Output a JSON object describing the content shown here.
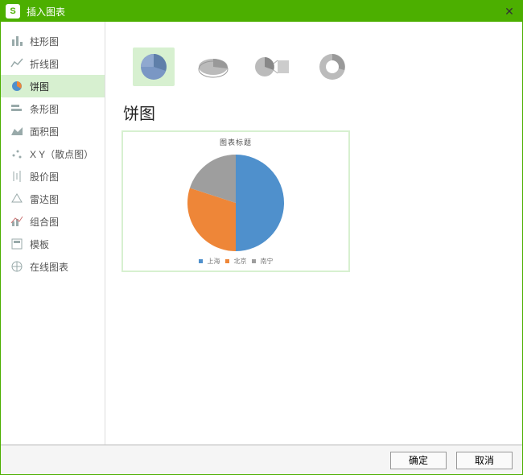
{
  "titlebar": {
    "app_badge": "S",
    "title": "插入图表",
    "close_glyph": "✕"
  },
  "sidebar": {
    "items": [
      {
        "label": "柱形图"
      },
      {
        "label": "折线图"
      },
      {
        "label": "饼图"
      },
      {
        "label": "条形图"
      },
      {
        "label": "面积图"
      },
      {
        "label": "X Y（散点图）"
      },
      {
        "label": "股价图"
      },
      {
        "label": "雷达图"
      },
      {
        "label": "组合图"
      },
      {
        "label": "模板"
      },
      {
        "label": "在线图表"
      }
    ],
    "selected_index": 2
  },
  "main": {
    "section_title": "饼图",
    "subtype_selected_index": 0,
    "preview_title": "图表标题",
    "legend_items": [
      "上海",
      "北京",
      "南宁"
    ]
  },
  "footer": {
    "ok_label": "确定",
    "cancel_label": "取消"
  },
  "colors": {
    "accent": "#4caf00",
    "selected_bg": "#d7f0d0",
    "slice1": "#4f90cc",
    "slice2": "#ee8638",
    "slice3": "#9e9e9e"
  },
  "chart_data": {
    "type": "pie",
    "title": "图表标题",
    "categories": [
      "上海",
      "北京",
      "南宁"
    ],
    "values": [
      50,
      30,
      20
    ],
    "colors": [
      "#4f90cc",
      "#ee8638",
      "#9e9e9e"
    ]
  }
}
